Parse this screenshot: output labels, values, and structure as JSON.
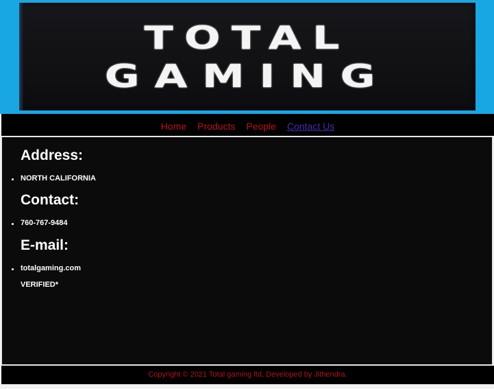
{
  "banner": {
    "logo_line1": "TOTAL",
    "logo_line2": "GAMING",
    "colors": {
      "frame": "#19a7e4",
      "panel": "#111114",
      "logo_text": "#f4f4f4"
    }
  },
  "nav": {
    "items": [
      {
        "label": "Home",
        "active": false
      },
      {
        "label": "Products",
        "active": false
      },
      {
        "label": "People",
        "active": false
      },
      {
        "label": "Contact Us",
        "active": true
      }
    ],
    "colors": {
      "link": "#c0101a",
      "active_link": "#4b2bb0",
      "background": "#000000"
    }
  },
  "content": {
    "address": {
      "heading": "Address:",
      "value": "NORTH CALIFORNIA"
    },
    "contact": {
      "heading": "Contact:",
      "value": "760-767-9484"
    },
    "email": {
      "heading": "E-mail:",
      "value": "totalgaming.com",
      "note": "VERIFIED*"
    },
    "colors": {
      "background": "#0b0b0c",
      "text": "#ffffff"
    }
  },
  "footer": {
    "text": "Copyright © 2021 Total gaming ltd, Developed by Jithendra.",
    "color": "#b0141c"
  }
}
